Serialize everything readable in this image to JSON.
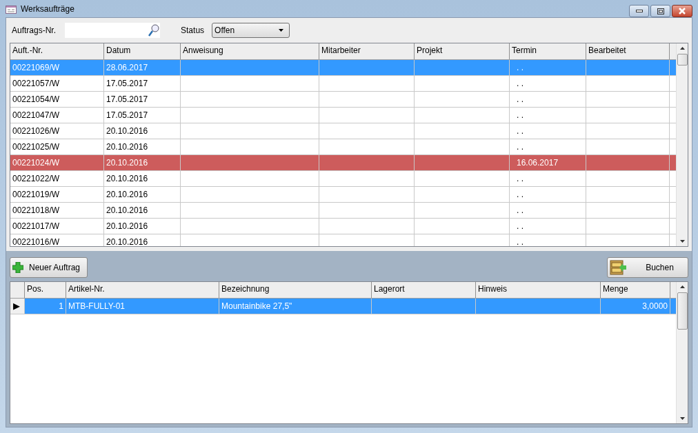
{
  "window": {
    "title": "Werksaufträge"
  },
  "filter": {
    "order_label": "Auftrags-Nr.",
    "status_label": "Status",
    "status_value": "Offen"
  },
  "orders": {
    "columns": [
      "Auft.-Nr.",
      "Datum",
      "Anweisung",
      "Mitarbeiter",
      "Projekt",
      "Termin",
      "Bearbeitet"
    ],
    "rows": [
      {
        "cells": [
          "00221069/W",
          "28.06.2017",
          "",
          "",
          "",
          ". .",
          ""
        ],
        "selected": true,
        "overdue": false
      },
      {
        "cells": [
          "00221057/W",
          "17.05.2017",
          "",
          "",
          "",
          ". .",
          ""
        ],
        "selected": false,
        "overdue": false
      },
      {
        "cells": [
          "00221054/W",
          "17.05.2017",
          "",
          "",
          "",
          ". .",
          ""
        ],
        "selected": false,
        "overdue": false
      },
      {
        "cells": [
          "00221047/W",
          "17.05.2017",
          "",
          "",
          "",
          ". .",
          ""
        ],
        "selected": false,
        "overdue": false
      },
      {
        "cells": [
          "00221026/W",
          "20.10.2016",
          "",
          "",
          "",
          ". .",
          ""
        ],
        "selected": false,
        "overdue": false
      },
      {
        "cells": [
          "00221025/W",
          "20.10.2016",
          "",
          "",
          "",
          ". .",
          ""
        ],
        "selected": false,
        "overdue": false
      },
      {
        "cells": [
          "00221024/W",
          "20.10.2016",
          "",
          "",
          "",
          "16.06.2017",
          ""
        ],
        "selected": false,
        "overdue": true
      },
      {
        "cells": [
          "00221022/W",
          "20.10.2016",
          "",
          "",
          "",
          ". .",
          ""
        ],
        "selected": false,
        "overdue": false
      },
      {
        "cells": [
          "00221019/W",
          "20.10.2016",
          "",
          "",
          "",
          ". .",
          ""
        ],
        "selected": false,
        "overdue": false
      },
      {
        "cells": [
          "00221018/W",
          "20.10.2016",
          "",
          "",
          "",
          ". .",
          ""
        ],
        "selected": false,
        "overdue": false
      },
      {
        "cells": [
          "00221017/W",
          "20.10.2016",
          "",
          "",
          "",
          ". .",
          ""
        ],
        "selected": false,
        "overdue": false
      },
      {
        "cells": [
          "00221016/W",
          "20.10.2016",
          "",
          "",
          "",
          ". .",
          ""
        ],
        "selected": false,
        "overdue": false
      }
    ]
  },
  "buttons": {
    "new": "Neuer Auftrag",
    "book": "Buchen"
  },
  "items": {
    "columns": [
      "Pos.",
      "Artikel-Nr.",
      "Bezeichnung",
      "Lagerort",
      "Hinweis",
      "Menge"
    ],
    "rows": [
      {
        "cells": [
          "1",
          "MTB-FULLY-01",
          "Mountainbike 27,5\"",
          "",
          "",
          "3,0000"
        ],
        "selected": true,
        "current_marker": "▶"
      }
    ]
  }
}
